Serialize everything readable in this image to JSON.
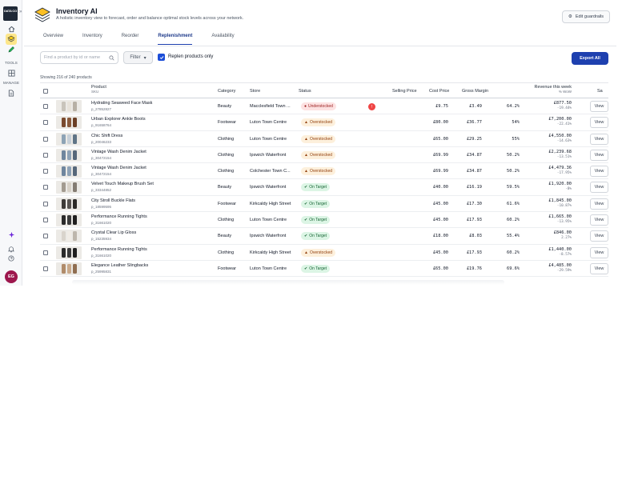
{
  "rail": {
    "logo_text": "DATA CO",
    "toggle_icon": "chevron-double-right-icon",
    "tools_label": "TOOLS",
    "manage_label": "MANAGE",
    "avatar_initials": "EG"
  },
  "header": {
    "title": "Inventory AI",
    "subtitle": "A holistic inventory view to forecast, order and balance optimal stock levels across your network.",
    "edit_button": "Edit guardrails"
  },
  "tabs": [
    {
      "label": "Overview",
      "active": false
    },
    {
      "label": "Inventory",
      "active": false
    },
    {
      "label": "Reorder",
      "active": false
    },
    {
      "label": "Replenishment",
      "active": true
    },
    {
      "label": "Availability",
      "active": false
    }
  ],
  "toolbar": {
    "search_placeholder": "Find a product by id or name",
    "filter_label": "Filter",
    "replen_only_label": "Replen products only",
    "replen_only_checked": true,
    "export_label": "Export All"
  },
  "showing_text": "Showing 216 of 240 products",
  "columns": {
    "product": "Product",
    "sku": "SKU",
    "category": "Category",
    "store": "Store",
    "status": "Status",
    "selling_price": "Selling Price",
    "cost_price": "Cost Price",
    "gross_margin": "Gross Margin",
    "revenue": "Revenue this week",
    "revenue_sub": "% WoW",
    "extra": "Sa"
  },
  "view_label": "View",
  "colors": {
    "accent": "#1e40af",
    "understocked": "#991b1b",
    "overstocked": "#92400e",
    "on_target": "#166534"
  },
  "rows": [
    {
      "name": "Hydrating Seaweed Face Mask",
      "sku": "p_27852827",
      "category": "Beauty",
      "store": "Macclesfield Town ...",
      "status": "Understocked",
      "status_type": "under",
      "alert": true,
      "selling": "£9.75",
      "cost": "£3.49",
      "margin": "64.2%",
      "revenue": "£877.50",
      "wow": "-19.44%",
      "thumb": [
        "#c9c4bb",
        "#e7e2da",
        "#b7b0a5"
      ]
    },
    {
      "name": "Urban Explorer Ankle Boots",
      "sku": "p_91658764",
      "category": "Footwear",
      "store": "Luton Town Centre",
      "status": "Overstocked",
      "status_type": "over",
      "alert": false,
      "selling": "£80.00",
      "cost": "£36.77",
      "margin": "54%",
      "revenue": "£7,200.00",
      "wow": "-22.41%",
      "thumb": [
        "#7a4a2e",
        "#8a5a3c",
        "#6b3f26"
      ]
    },
    {
      "name": "Chic Shift Dress",
      "sku": "p_20046233",
      "category": "Clothing",
      "store": "Luton Town Centre",
      "status": "Overstocked",
      "status_type": "over",
      "alert": false,
      "selling": "£65.00",
      "cost": "£29.25",
      "margin": "55%",
      "revenue": "£4,550.00",
      "wow": "-14.63%",
      "thumb": [
        "#8da3b5",
        "#c7d0d8",
        "#5f7486"
      ]
    },
    {
      "name": "Vintage Wash Denim Jacket",
      "sku": "p_30472154",
      "category": "Clothing",
      "store": "Ipswich Waterfront",
      "status": "Overstocked",
      "status_type": "over",
      "alert": false,
      "selling": "£69.99",
      "cost": "£34.87",
      "margin": "50.2%",
      "revenue": "£2,239.68",
      "wow": "-13.51%",
      "thumb": [
        "#6f869e",
        "#8ea2b6",
        "#56677a"
      ]
    },
    {
      "name": "Vintage Wash Denim Jacket",
      "sku": "p_30472154",
      "category": "Clothing",
      "store": "Colchester Town C...",
      "status": "Overstocked",
      "status_type": "over",
      "alert": false,
      "selling": "£69.99",
      "cost": "£34.87",
      "margin": "50.2%",
      "revenue": "£4,479.36",
      "wow": "-17.95%",
      "thumb": [
        "#6f869e",
        "#8ea2b6",
        "#56677a"
      ]
    },
    {
      "name": "Velvet Touch Makeup Brush Set",
      "sku": "p_33344852",
      "category": "Beauty",
      "store": "Ipswich Waterfront",
      "status": "On Target",
      "status_type": "ontarget",
      "alert": false,
      "selling": "£40.00",
      "cost": "£16.19",
      "margin": "59.5%",
      "revenue": "£1,920.00",
      "wow": "-8%",
      "thumb": [
        "#a39b90",
        "#d8d2c8",
        "#847c72"
      ]
    },
    {
      "name": "City Stroll Buckle Flats",
      "sku": "p_18599595",
      "category": "Footwear",
      "store": "Kirkcaldy High Street",
      "status": "On Target",
      "status_type": "ontarget",
      "alert": false,
      "selling": "£45.00",
      "cost": "£17.30",
      "margin": "61.6%",
      "revenue": "£1,845.00",
      "wow": "-10.87%",
      "thumb": [
        "#3d3a37",
        "#575350",
        "#2b2927"
      ]
    },
    {
      "name": "Performance Running Tights",
      "sku": "p_31661020",
      "category": "Clothing",
      "store": "Luton Town Centre",
      "status": "On Target",
      "status_type": "ontarget",
      "alert": false,
      "selling": "£45.00",
      "cost": "£17.93",
      "margin": "60.2%",
      "revenue": "£1,665.00",
      "wow": "-13.95%",
      "thumb": [
        "#2a2a2a",
        "#3a3a3a",
        "#1f1f1f"
      ]
    },
    {
      "name": "Crystal Clear Lip Gloss",
      "sku": "p_15235934",
      "category": "Beauty",
      "store": "Ipswich Waterfront",
      "status": "On Target",
      "status_type": "ontarget",
      "alert": false,
      "selling": "£18.00",
      "cost": "£8.03",
      "margin": "55.4%",
      "revenue": "£846.00",
      "wow": "2.27%",
      "thumb": [
        "#d9d4cc",
        "#f0ece6",
        "#bdb6ac"
      ]
    },
    {
      "name": "Performance Running Tights",
      "sku": "p_31661020",
      "category": "Clothing",
      "store": "Kirkcaldy High Street",
      "status": "Overstocked",
      "status_type": "over",
      "alert": false,
      "selling": "£45.00",
      "cost": "£17.93",
      "margin": "60.2%",
      "revenue": "£1,440.00",
      "wow": "-8.57%",
      "thumb": [
        "#2a2a2a",
        "#3a3a3a",
        "#1f1f1f"
      ]
    },
    {
      "name": "Elegance Leather Slingbacks",
      "sku": "p_25995831",
      "category": "Footwear",
      "store": "Luton Town Centre",
      "status": "On Target",
      "status_type": "ontarget",
      "alert": false,
      "selling": "£65.00",
      "cost": "£19.76",
      "margin": "69.6%",
      "revenue": "£4,485.00",
      "wow": "-29.59%",
      "thumb": [
        "#b08b6a",
        "#c9a98b",
        "#8f6d50"
      ]
    }
  ]
}
